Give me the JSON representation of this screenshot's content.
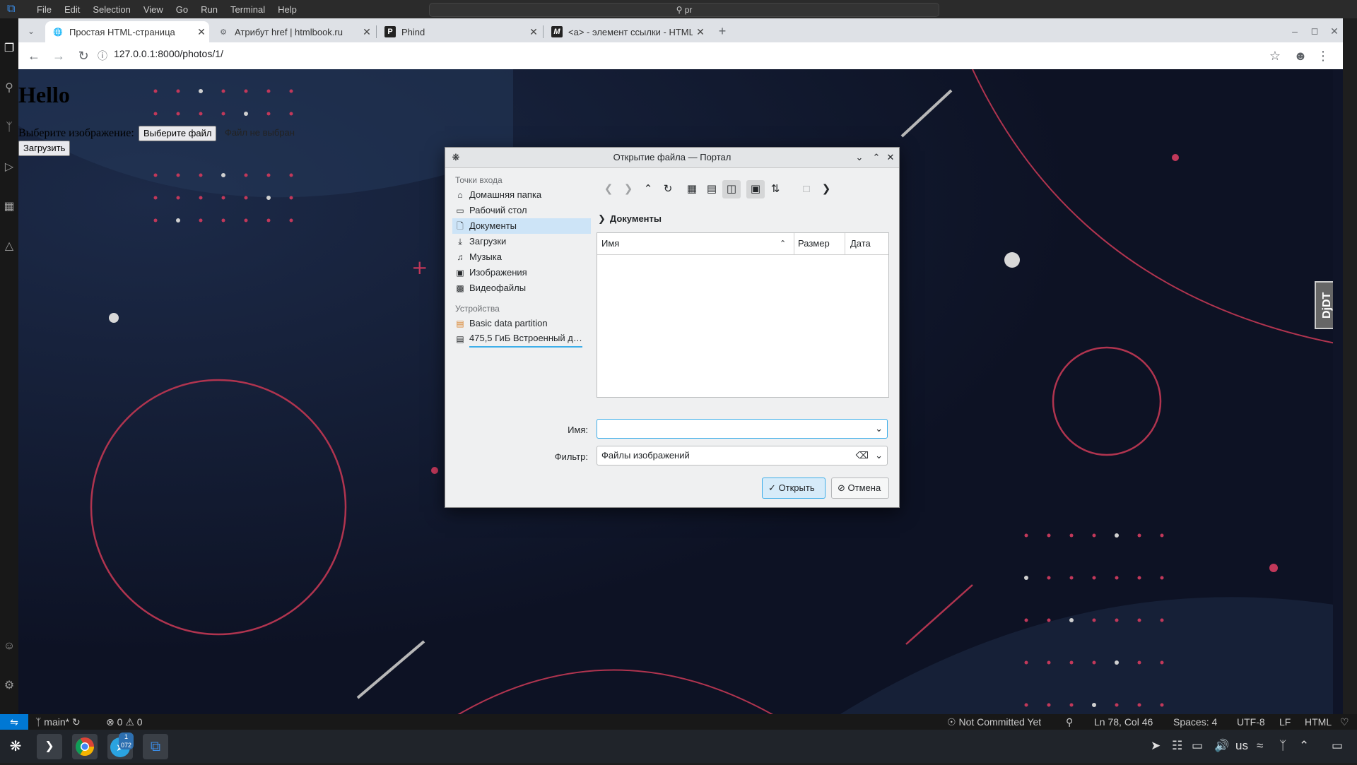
{
  "vscode": {
    "menu": [
      "File",
      "Edit",
      "Selection",
      "View",
      "Go",
      "Run",
      "Terminal",
      "Help"
    ],
    "search_text": "pr"
  },
  "browser": {
    "tabs": [
      {
        "title": "Простая HTML-страница",
        "favicon": "globe-icon",
        "active": true
      },
      {
        "title": "Атрибут href | htmlbook.ru",
        "favicon": "gear-icon",
        "active": false
      },
      {
        "title": "Phind",
        "favicon": "phind-icon",
        "active": false
      },
      {
        "title": "<a> - элемент ссылки - HTML",
        "favicon": "mdn-icon",
        "active": false
      }
    ],
    "new_tab": "+",
    "url": "127.0.0.1:8000/photos/1/"
  },
  "page": {
    "heading": "Hello",
    "label": "Выберите изображение:",
    "file_button": "Выберите файл",
    "no_file": "Файл не выбран",
    "upload_button": "Загрузить",
    "djdt": "DjDT"
  },
  "dialog": {
    "title": "Открытие файла — Портал",
    "places_header": "Точки входа",
    "places": [
      {
        "label": "Домашняя папка",
        "icon": "home-icon",
        "selected": false
      },
      {
        "label": "Рабочий стол",
        "icon": "desktop-icon",
        "selected": false
      },
      {
        "label": "Документы",
        "icon": "documents-icon",
        "selected": true
      },
      {
        "label": "Загрузки",
        "icon": "download-icon",
        "selected": false
      },
      {
        "label": "Музыка",
        "icon": "music-icon",
        "selected": false
      },
      {
        "label": "Изображения",
        "icon": "image-icon",
        "selected": false
      },
      {
        "label": "Видеофайлы",
        "icon": "video-icon",
        "selected": false
      }
    ],
    "devices_header": "Устройства",
    "devices": [
      {
        "label": "Basic data partition",
        "icon": "drive-icon"
      },
      {
        "label": "475,5 ГиБ Встроенный д…",
        "icon": "drive-icon"
      }
    ],
    "breadcrumb": "Документы",
    "columns": [
      "Имя",
      "Размер",
      "Дата"
    ],
    "name_label": "Имя:",
    "name_value": "",
    "filter_label": "Фильтр:",
    "filter_value": "Файлы изображений",
    "open_button": "Открыть",
    "cancel_button": "Отмена"
  },
  "statusbar": {
    "branch": "main*",
    "errors": "0",
    "warnings": "0",
    "git_status": "Not Committed Yet",
    "position": "Ln 78, Col 46",
    "spaces": "Spaces: 4",
    "encoding": "UTF-8",
    "eol": "LF",
    "language": "HTML"
  },
  "taskbar": {
    "telegram_badge": "1 072",
    "keyboard_layout": "us"
  }
}
